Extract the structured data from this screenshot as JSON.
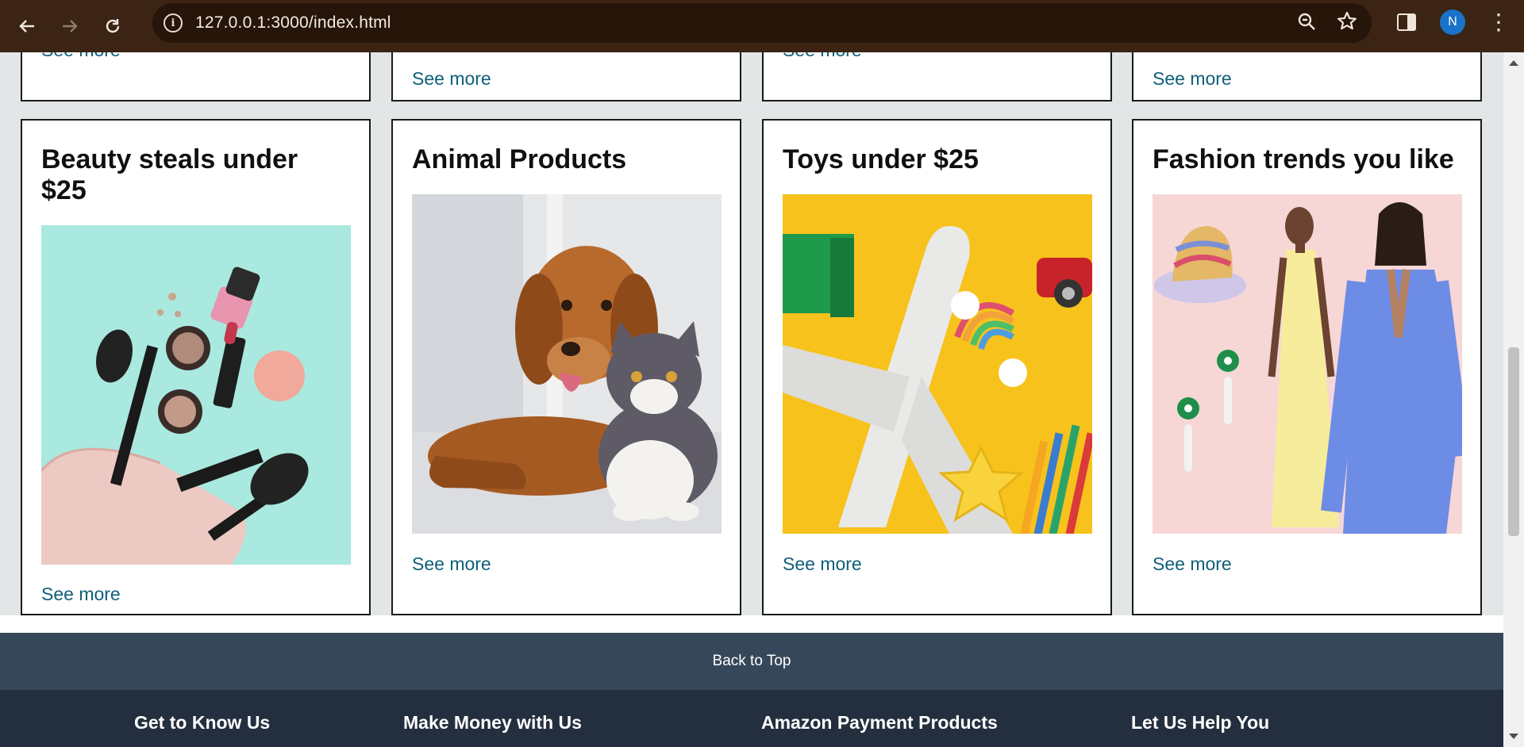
{
  "browser": {
    "url": "127.0.0.1:3000/index.html",
    "avatar_initial": "N",
    "accent": "#3b2414"
  },
  "partial_cards": [
    {
      "see_more": "See more"
    },
    {
      "see_more": "See more"
    },
    {
      "see_more": "See more"
    },
    {
      "see_more": "See more"
    }
  ],
  "cards": [
    {
      "title": "Beauty steals under $25",
      "image": "makeup-cosmetics-photo",
      "see_more": "See more"
    },
    {
      "title": "Animal Products",
      "image": "dog-and-cat-photo",
      "see_more": "See more"
    },
    {
      "title": "Toys under $25",
      "image": "toy-airplane-photo",
      "see_more": "See more"
    },
    {
      "title": "Fashion trends you like",
      "image": "fashion-models-photo",
      "see_more": "See more"
    }
  ],
  "back_to_top": "Back to Top",
  "footer": {
    "columns": [
      "Get to Know Us",
      "Make Money with Us",
      "Amazon Payment Products",
      "Let Us Help You"
    ]
  },
  "colors": {
    "link": "#0f5f7a",
    "page_bg": "#e3e6e6",
    "back_to_top_bg": "#37475a",
    "footer_bg": "#232f3e"
  }
}
